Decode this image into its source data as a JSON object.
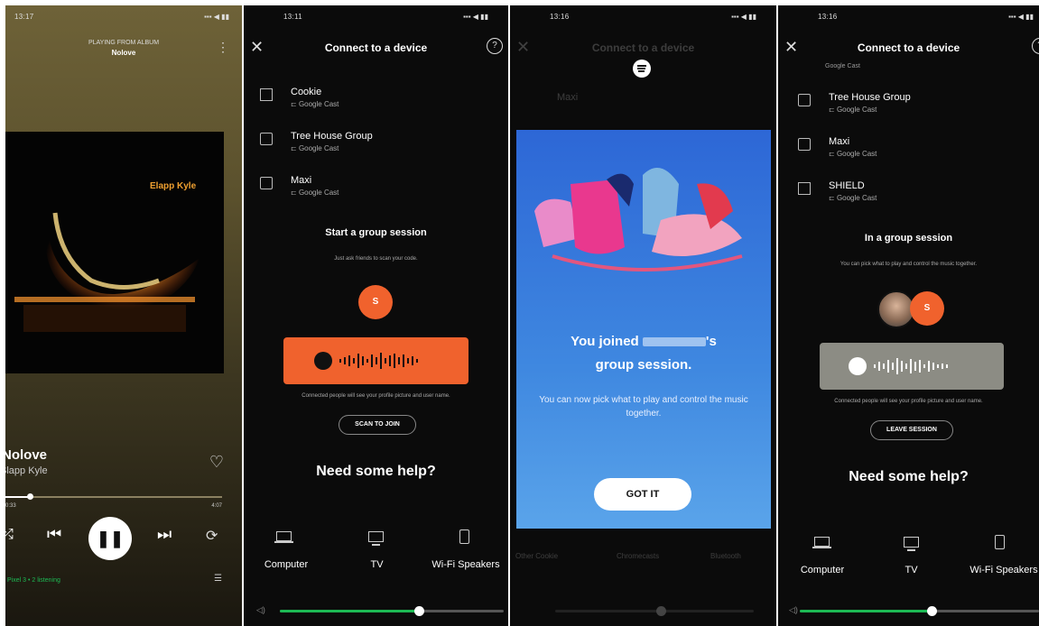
{
  "colors": {
    "spotify_green": "#1db954",
    "accent_orange": "#f0622d",
    "modal_blue": "#3f88e0",
    "dark_bg": "#0b0b0b"
  },
  "player": {
    "status_time": "13:17",
    "playing_from": "PLAYING FROM ALBUM",
    "album": "Nolove",
    "art_text": "Elapp Kyle",
    "track_title": "Nolove",
    "artist": "Slapp Kyle",
    "time_elapsed": "0:33",
    "time_total": "4:07",
    "progress_fraction": 0.12,
    "device_listening": "Pixel 3 • 2 listening"
  },
  "connect1": {
    "status_time": "13:11",
    "title": "Connect to a device",
    "devices": [
      {
        "name": "Cookie",
        "sub": "Google Cast",
        "icon": "tv-icon"
      },
      {
        "name": "Tree House Group",
        "sub": "Google Cast",
        "icon": "speaker-icon"
      },
      {
        "name": "Maxi",
        "sub": "Google Cast",
        "icon": "speaker-icon"
      }
    ],
    "group_title": "Start a group session",
    "group_sub": "Just ask friends to scan your code.",
    "avatar_letter": "S",
    "connected_note": "Connected people will see your profile picture and user name.",
    "scan_button": "SCAN TO JOIN",
    "help_title": "Need some help?",
    "categories": [
      "Computer",
      "TV",
      "Wi-Fi Speakers"
    ],
    "volume_fraction": 0.62
  },
  "modal": {
    "status_time": "13:16",
    "bg_title": "Connect to a device",
    "bg_device": "Maxi",
    "bg_categories": [
      "Other Cookie",
      "Chromecasts",
      "Bluetooth"
    ],
    "joined_prefix": "You joined",
    "joined_suffix": "'s",
    "joined_line2": "group session.",
    "message": "You can now pick what to play and control the music together.",
    "button": "GOT IT"
  },
  "connect2": {
    "status_time": "13:16",
    "title": "Connect to a device",
    "top_cut": "Google Cast",
    "devices": [
      {
        "name": "Tree House Group",
        "sub": "Google Cast",
        "icon": "speaker-icon"
      },
      {
        "name": "Maxi",
        "sub": "Google Cast",
        "icon": "speaker-icon"
      },
      {
        "name": "SHIELD",
        "sub": "Google Cast",
        "icon": "tv-icon"
      }
    ],
    "group_title": "In a group session",
    "group_sub": "You can pick what to play and control the music together.",
    "avatar_letter": "S",
    "connected_note": "Connected people will see your profile picture and user name.",
    "leave_button": "LEAVE SESSION",
    "help_title": "Need some help?",
    "categories": [
      "Computer",
      "TV",
      "Wi-Fi Speakers"
    ],
    "volume_fraction": 0.55
  }
}
